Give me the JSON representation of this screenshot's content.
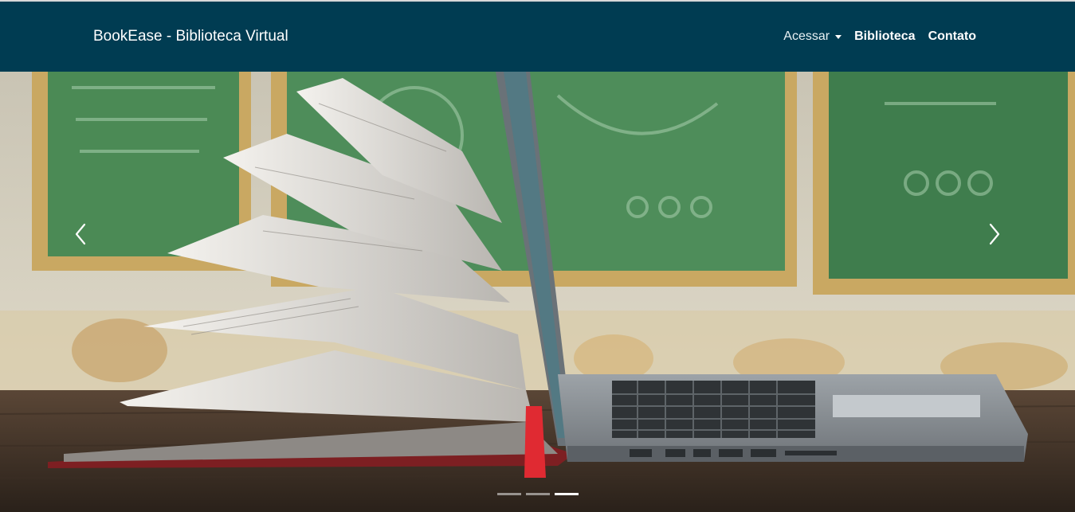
{
  "navbar": {
    "brand": "BookEase - Biblioteca Virtual",
    "links": {
      "acessar": "Acessar",
      "biblioteca": "Biblioteca",
      "contato": "Contato"
    },
    "background_color": "#003c52"
  },
  "carousel": {
    "slide_image": "open book with flying pages next to laptop on wooden desk, green chalkboards in background",
    "prev_icon": "chevron-left-icon",
    "next_icon": "chevron-right-icon",
    "slide_count": 3,
    "active_slide": 3
  }
}
